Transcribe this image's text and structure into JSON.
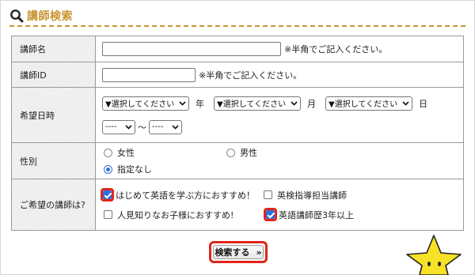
{
  "header": {
    "title": "講師検索",
    "icon": "search-icon",
    "accent_color": "#c8932e"
  },
  "form": {
    "name": {
      "label": "講師名",
      "value": "",
      "note": "※半角でご記入ください。"
    },
    "id": {
      "label": "講師ID",
      "value": "",
      "note": "※半角でご記入ください。"
    },
    "date": {
      "label": "希望日時",
      "year_select": "▼選択してください",
      "year_unit": "年",
      "month_select": "▼選択してください",
      "month_unit": "月",
      "day_select": "▼選択してください",
      "day_unit": "日",
      "time_from": "----",
      "range_sep": "〜",
      "time_to": "----"
    },
    "gender": {
      "label": "性別",
      "options": [
        {
          "label": "女性",
          "selected": false
        },
        {
          "label": "男性",
          "selected": false
        },
        {
          "label": "指定なし",
          "selected": true
        }
      ]
    },
    "preference": {
      "label": "ご希望の講師は?",
      "options": [
        {
          "label": "はじめて英語を学ぶ方におすすめ！",
          "checked": true,
          "highlighted": true
        },
        {
          "label": "英検指導担当講師",
          "checked": false,
          "highlighted": false
        },
        {
          "label": "人見知りなお子様におすすめ!",
          "checked": false,
          "highlighted": false
        },
        {
          "label": "英語講師歴3年以上",
          "checked": true,
          "highlighted": true
        }
      ]
    }
  },
  "actions": {
    "search_label": "検索する",
    "search_arrow": "»",
    "highlight_color": "#e0251b"
  },
  "decoration": {
    "mascot": "star-mascot-icon",
    "mascot_color": "#f7e227"
  }
}
